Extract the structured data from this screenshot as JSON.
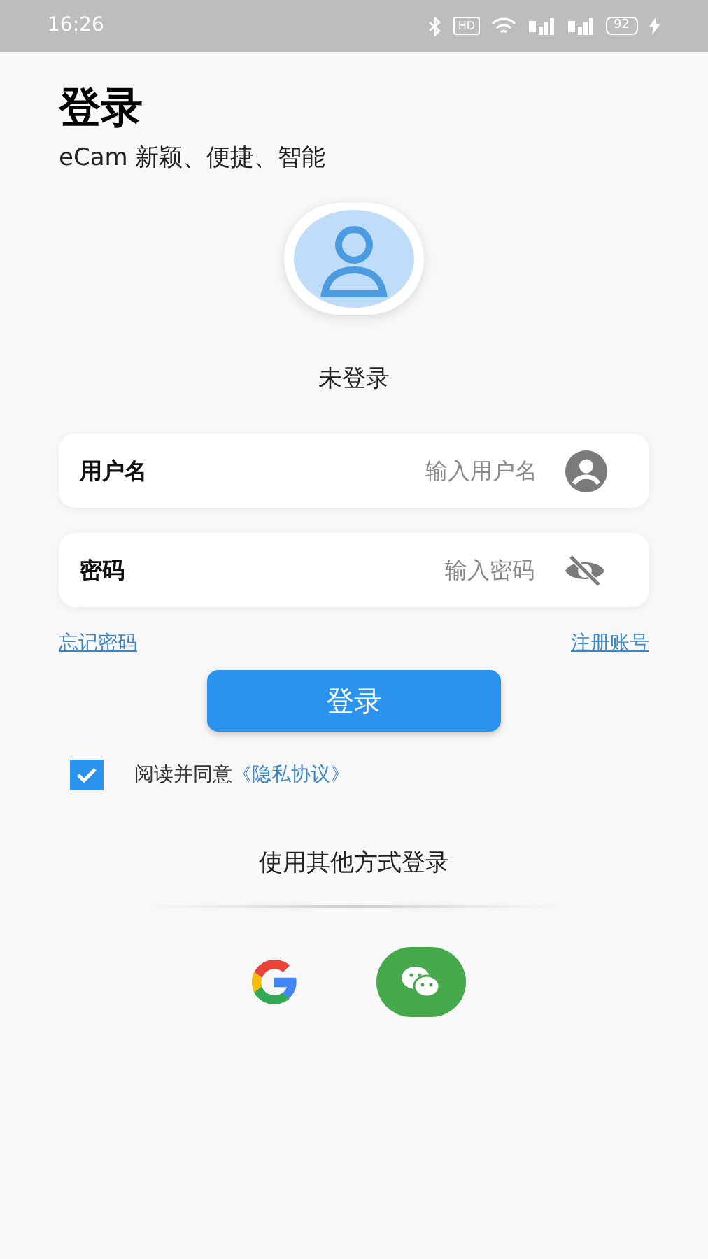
{
  "status_bar": {
    "time": "16:26",
    "hd": "HD",
    "battery": "92"
  },
  "header": {
    "title": "登录",
    "subtitle": "eCam 新颖、便捷、智能"
  },
  "profile": {
    "status": "未登录"
  },
  "fields": [
    {
      "kind": "username",
      "label": "用户名",
      "placeholder": "输入用户名"
    },
    {
      "kind": "password",
      "label": "密码",
      "placeholder": "输入密码"
    }
  ],
  "links": {
    "forgot": "忘记密码",
    "register": "注册账号"
  },
  "login_button": "登录",
  "agreement": {
    "checked": true,
    "text": "阅读并同意",
    "link": "《隐私协议》"
  },
  "other_login": {
    "title": "使用其他方式登录",
    "providers": [
      {
        "kind": "google"
      },
      {
        "kind": "wechat"
      }
    ]
  }
}
